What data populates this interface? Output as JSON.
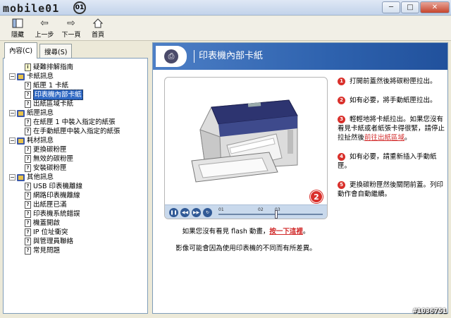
{
  "titlebar": {
    "logo_text": "mobile01",
    "logo_badge": "01",
    "minimize": "─",
    "maximize": "□",
    "close": "✕"
  },
  "toolbar": {
    "hide_label": "隱藏",
    "back_label": "上一步",
    "forward_label": "下一頁",
    "home_label": "首頁"
  },
  "nav_tabs": {
    "contents": "內容(C)",
    "search": "搜尋(S)"
  },
  "tree": {
    "troubleshooting": "疑難排解指南",
    "paper_jam": "卡紙訊息",
    "jam_tray1": "紙匣 1 卡紙",
    "jam_inside": "印表機內部卡紙",
    "jam_output": "出紙區域卡紙",
    "tray_msgs": "紙匣訊息",
    "tray1_load": "在紙匣 1 中裝入指定的紙張",
    "manual_load": "在手動紙匣中裝入指定的紙張",
    "supply_msgs": "耗材訊息",
    "replace_toner": "更換碳粉匣",
    "invalid_toner": "無效的碳粉匣",
    "install_toner": "安裝碳粉匣",
    "other_msgs": "其他訊息",
    "usb_offline": "USB 印表機離線",
    "net_offline": "網路印表機離線",
    "output_full": "出紙匣已滿",
    "system_error": "印表機系統錯誤",
    "cover_open": "機蓋開啟",
    "ip_conflict": "IP 位址衝突",
    "contact_admin": "與管理員聯絡",
    "faq": "常見問題"
  },
  "content": {
    "title": "印表機內部卡紙",
    "video_badge": "2",
    "tick_1": "01",
    "tick_2": "02",
    "tick_3": "03",
    "caption_prefix": "如果您沒有看見 flash 動畫，",
    "caption_link": "按一下這裡",
    "caption_suffix": "。",
    "caption_note": "影像可能會因為使用印表機的不同而有所差異。",
    "steps": [
      {
        "num": "1",
        "text": "打開前蓋然後將碳粉匣拉出。"
      },
      {
        "num": "2",
        "text": "如有必要，將手動紙匣拉出。"
      },
      {
        "num": "3",
        "text_before": "輕輕地將卡紙拉出。如果您沒有看見卡紙或者紙張卡得很緊，請停止拉扯然後",
        "link": "前往出紙區域",
        "text_after": "。"
      },
      {
        "num": "4",
        "text": "如有必要，請重新插入手動紙匣。"
      },
      {
        "num": "5",
        "text": "更換碳粉匣然後關閉前蓋。列印動作會自動繼續。"
      }
    ]
  },
  "watermark": "#1036751"
}
